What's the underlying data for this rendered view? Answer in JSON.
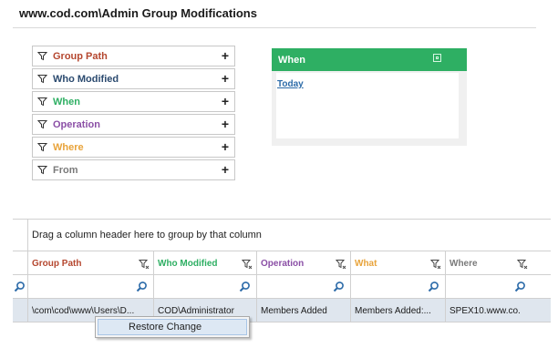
{
  "page": {
    "title": "www.cod.com\\Admin Group Modifications"
  },
  "filters": [
    {
      "label": "Group Path",
      "color": "#b5472f"
    },
    {
      "label": "Who Modified",
      "color": "#2b4a6f"
    },
    {
      "label": "When",
      "color": "#2eaf63"
    },
    {
      "label": "Operation",
      "color": "#8b4fa6"
    },
    {
      "label": "Where",
      "color": "#e8a33a"
    },
    {
      "label": "From",
      "color": "#7a7a7a"
    }
  ],
  "when_panel": {
    "title": "When",
    "link": "Today",
    "color": "#2eaf63"
  },
  "grid": {
    "group_prompt": "Drag a column header here to group by that column",
    "columns": [
      {
        "label": "Group Path",
        "color": "#b5472f"
      },
      {
        "label": "Who Modified",
        "color": "#2eaf63"
      },
      {
        "label": "Operation",
        "color": "#8b4fa6"
      },
      {
        "label": "What",
        "color": "#e8a33a"
      },
      {
        "label": "Where",
        "color": "#7a7a7a"
      }
    ],
    "row": [
      "\\com\\cod\\www\\Users\\D...",
      "COD\\Administrator",
      "Members Added",
      "Members Added:...",
      "SPEX10.www.co."
    ]
  },
  "context_menu": {
    "item": "Restore Change"
  }
}
